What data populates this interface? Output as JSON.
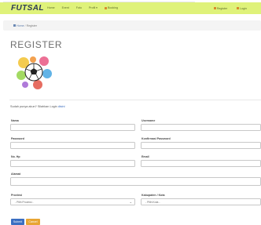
{
  "brand": {
    "name": "FUTSAL"
  },
  "nav": {
    "items": [
      {
        "label": "Home",
        "icon": ""
      },
      {
        "label": "Event",
        "icon": ""
      },
      {
        "label": "Foto",
        "icon": ""
      },
      {
        "label": "Profil ▾",
        "icon": ""
      },
      {
        "label": "Booking",
        "icon": "calendar-icon"
      }
    ],
    "right": {
      "register_label": "Register",
      "login_label": "Login"
    }
  },
  "breadcrumb": {
    "home": "Home",
    "separator": "/",
    "current": "Register"
  },
  "page": {
    "title": "REGISTER"
  },
  "already": {
    "text": "Sudah punya akun? Silahkan Login",
    "link": "disini"
  },
  "form": {
    "nama_label": "Nama",
    "username_label": "Username",
    "password_label": "Password",
    "konfirmasi_label": "Konfirmasi Password",
    "nohp_label": "No. Hp",
    "email_label": "Email",
    "alamat_label": "Alamat",
    "provinsi_label": "Provinsi",
    "provinsi_value": "- Pilih Provinsi -",
    "kabupaten_label": "Kabupaten / Kota",
    "kabupaten_value": "- Pilih Kota -",
    "submit_label": "Submit",
    "cancel_label": "Cancel"
  },
  "colors": {
    "navbar": "#dff27a",
    "accent_icon": "#d98a2c",
    "submit": "#3b6fc2",
    "cancel": "#e8a533"
  }
}
